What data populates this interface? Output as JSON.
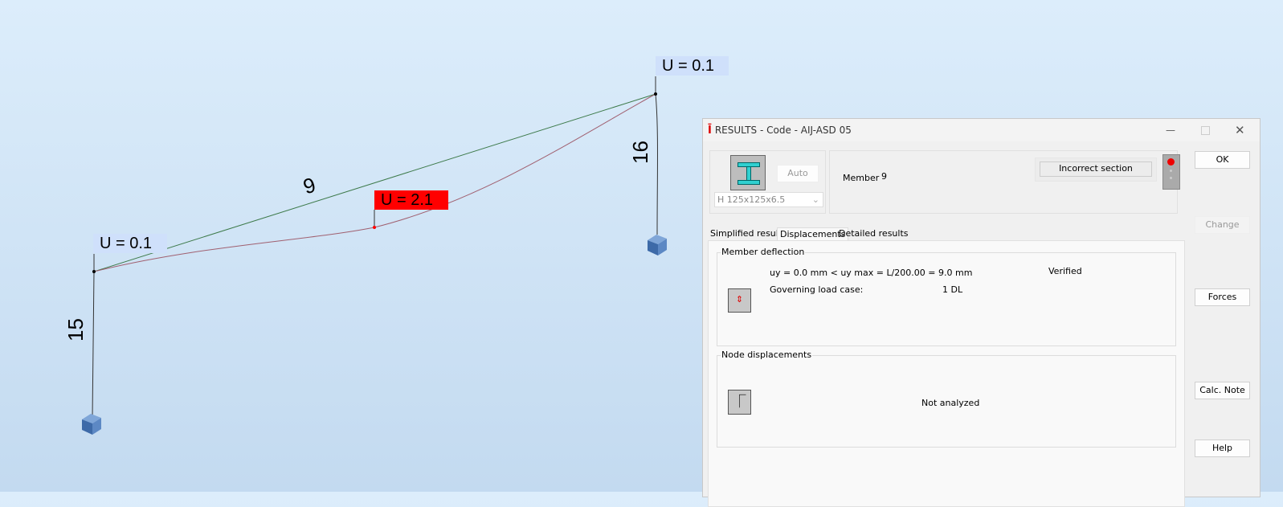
{
  "scene": {
    "labels": [
      {
        "text": "U = 0.1",
        "status": "ok"
      },
      {
        "text": "U = 2.1",
        "status": "fail"
      },
      {
        "text": "U = 0.1",
        "status": "ok"
      }
    ],
    "members": {
      "beam": "9",
      "left_column": "15",
      "right_column": "16"
    },
    "colors": {
      "beam": "#3d7a4a",
      "deformed": "#a06070",
      "fail": "#ff0000"
    }
  },
  "dialog": {
    "title": "RESULTS - Code - AIJ-ASD 05",
    "auto_label": "Auto",
    "section": "H 125x125x6.5",
    "member_label": "Member",
    "member_value": "9",
    "status": "Incorrect section",
    "tabs": [
      "Simplified results",
      "Displacements",
      "Detailed results"
    ],
    "active_tab": "Displacements",
    "deflection": {
      "title": "Member deflection",
      "formula": "uy = 0.0 mm  <  uy max = L/200.00 = 9.0 mm",
      "result": "Verified",
      "load_case_label": "Governing load case:",
      "load_case": "1 DL"
    },
    "node": {
      "title": "Node displacements",
      "result": "Not analyzed"
    },
    "buttons": {
      "ok": "OK",
      "change": "Change",
      "forces": "Forces",
      "calc_note": "Calc. Note",
      "help": "Help"
    }
  }
}
